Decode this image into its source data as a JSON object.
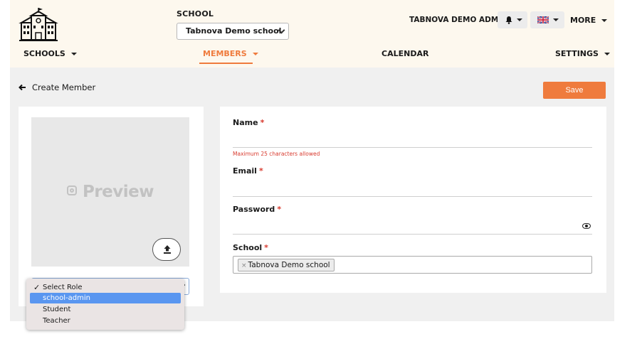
{
  "header": {
    "school_label": "SCHOOL",
    "school_selected": "Tabnova Demo school",
    "admin_name": "TABNOVA DEMO ADMIN",
    "more_label": "MORE"
  },
  "nav": {
    "schools": "SCHOOLS",
    "members": "MEMBERS",
    "calendar": "CALENDAR",
    "settings": "SETTINGS",
    "active": "MEMBERS"
  },
  "page": {
    "back_label": "Create Member",
    "save_label": "Save"
  },
  "photo": {
    "preview_text": "Preview"
  },
  "form": {
    "name_label": "Name",
    "name_hint": "Maximum 25 characters allowed",
    "email_label": "Email",
    "password_label": "Password",
    "school_label": "School",
    "school_chip": "Tabnova Demo school",
    "required_mark": "*"
  },
  "role_dropdown": {
    "options": [
      "Select Role",
      "school-admin",
      "Student",
      "Teacher"
    ],
    "checked": "Select Role",
    "highlighted": "school-admin"
  },
  "colors": {
    "accent": "#ef7b3d",
    "header_bg": "#fdf8ee",
    "required": "#d83a2e",
    "highlight": "#5a96f0"
  }
}
